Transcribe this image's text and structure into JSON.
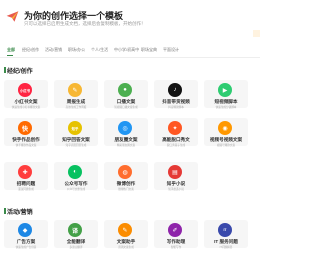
{
  "header": {
    "title": "为你的创作选择一个模板",
    "subtitle": "只可以选择已启用生成文档，选择后会复制模板，开始创作！"
  },
  "tabs": [
    "全部",
    "经纪/创作",
    "活动/营销",
    "职场/办公",
    "个人/生活",
    "中小学/初高中",
    "职场宝典",
    "平面设计"
  ],
  "sections": [
    {
      "title": "经纪/创作",
      "cards": [
        {
          "title": "小红书文案",
          "desc": "快速生成小红书爆款文案",
          "icon": "xiaohongshu-icon",
          "icon_text": "小红书",
          "color": "#ff2442"
        },
        {
          "title": "周报生成",
          "desc": "高效生成工作周报",
          "icon": "pencil-icon",
          "icon_text": "✎",
          "color": "#f7b733"
        },
        {
          "title": "口播文案",
          "desc": "短视频口播文案生成",
          "icon": "mic-icon",
          "icon_text": "●",
          "color": "#4caf50"
        },
        {
          "title": "抖音带货视频",
          "desc": "抖音爆款脚本",
          "icon": "tiktok-icon",
          "icon_text": "♪",
          "color": "#111111"
        },
        {
          "title": "短视频脚本",
          "desc": "快速生成分镜脚本",
          "icon": "play-icon",
          "icon_text": "▶",
          "color": "#2ecc71"
        },
        {
          "title": "快手作品创作",
          "desc": "快手爆款作品文案",
          "icon": "kuaishou-icon",
          "icon_text": "快",
          "color": "#ff6a00"
        },
        {
          "title": "知乎回答文案",
          "desc": "知乎高赞回答生成",
          "icon": "zhihu-icon",
          "icon_text": "知乎",
          "color": "#e6c200"
        },
        {
          "title": "朋友圈文案",
          "desc": "精彩朋友圈文案",
          "icon": "moments-icon",
          "icon_text": "◎",
          "color": "#2196f3"
        },
        {
          "title": "高能脱口秀文",
          "desc": "脱口秀段子生成",
          "icon": "flame-icon",
          "icon_text": "✦",
          "color": "#ff5722"
        },
        {
          "title": "视频号视频文案",
          "desc": "视频号爆款文案",
          "icon": "video-icon",
          "icon_text": "◉",
          "color": "#ff9800"
        },
        {
          "title": "招聘问题",
          "desc": "面试问题生成",
          "icon": "people-icon",
          "icon_text": "✚",
          "color": "#ff3d3d"
        },
        {
          "title": "公众号写作",
          "desc": "公众号文章生成",
          "icon": "wechat-icon",
          "icon_text": "◐",
          "color": "#07c160"
        },
        {
          "title": "微博创作",
          "desc": "微博热门文案",
          "icon": "weibo-icon",
          "icon_text": "◍",
          "color": "#ff6d2e"
        },
        {
          "title": "知乎小说",
          "desc": "知乎盐选小说",
          "icon": "book-icon",
          "icon_text": "▤",
          "color": "#e53935"
        }
      ]
    },
    {
      "title": "活动/营销",
      "cards": [
        {
          "title": "广告方案",
          "desc": "快速生成广告创意",
          "icon": "ad-icon",
          "icon_text": "◆",
          "color": "#1e88e5"
        },
        {
          "title": "全能翻译",
          "desc": "多语言翻译",
          "icon": "translate-icon",
          "icon_text": "译",
          "color": "#43a047"
        },
        {
          "title": "文案助手",
          "desc": "营销文案生成",
          "icon": "doc-icon",
          "icon_text": "✎",
          "color": "#fb8c00"
        },
        {
          "title": "写作助理",
          "desc": "智能写作",
          "icon": "write-icon",
          "icon_text": "✐",
          "color": "#8e24aa"
        },
        {
          "title": "IT 服务问题",
          "desc": "IT问题解答",
          "icon": "it-icon",
          "icon_text": "IT",
          "color": "#3949ab"
        }
      ]
    }
  ]
}
